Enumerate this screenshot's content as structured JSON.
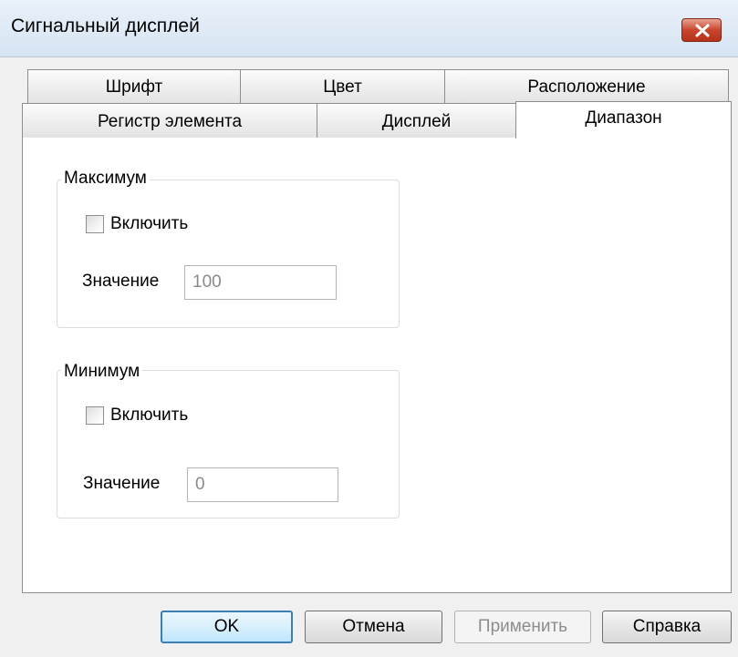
{
  "window": {
    "title": "Сигнальный дисплей",
    "close_icon": "close-icon"
  },
  "tabs": {
    "row_back": [
      "Шрифт",
      "Цвет",
      "Расположение"
    ],
    "row_front": [
      "Регистр элемента",
      "Дисплей",
      "Диапазон"
    ],
    "active": "Диапазон"
  },
  "max_group": {
    "legend": "Максимум",
    "enable_label": "Включить",
    "enabled": false,
    "value_label": "Значение",
    "value": "100"
  },
  "min_group": {
    "legend": "Минимум",
    "enable_label": "Включить",
    "enabled": false,
    "value_label": "Значение",
    "value": "0"
  },
  "buttons": {
    "ok": "OK",
    "cancel": "Отмена",
    "apply": "Применить",
    "help": "Справка"
  },
  "colors": {
    "close_button": "#c8452d",
    "default_button_border": "#3c7fb1"
  }
}
